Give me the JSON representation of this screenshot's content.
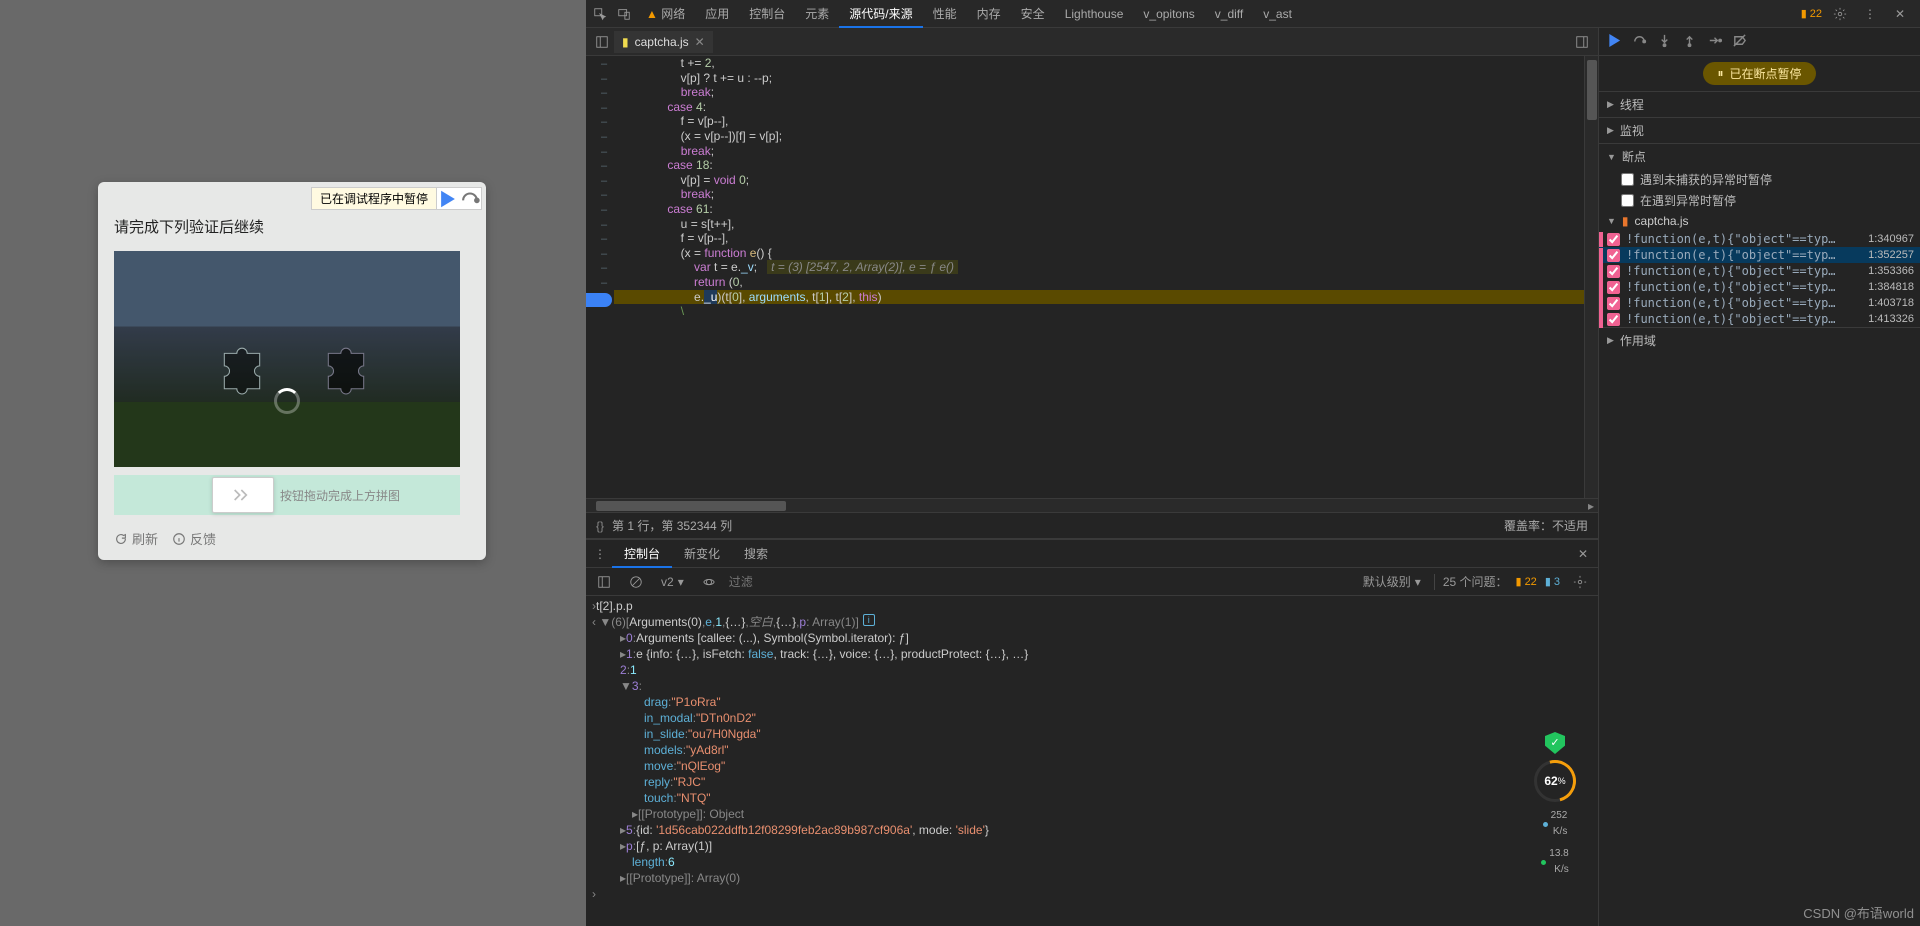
{
  "captcha": {
    "debugger_strip": "已在调试程序中暂停",
    "title": "请完成下列验证后继续",
    "slider_hint": "按钮拖动完成上方拼图",
    "refresh": "刷新",
    "feedback": "反馈"
  },
  "devtools": {
    "tabs": {
      "network": "网络",
      "application": "应用",
      "console": "控制台",
      "elements": "元素",
      "sources": "源代码/来源",
      "performance": "性能",
      "memory": "内存",
      "security": "安全",
      "lighthouse": "Lighthouse",
      "v_options": "v_opitons",
      "v_diff": "v_diff",
      "v_ast": "v_ast"
    },
    "issues_count": "22",
    "file_tab": "captcha.js",
    "status": {
      "pos": "第 1 行，第 352344 列",
      "coverage": "覆盖率：不适用"
    },
    "pause_banner": "已在断点暂停",
    "sections": {
      "threads": "线程",
      "watch": "监视",
      "breakpoints": "断点",
      "scope": "作用域"
    },
    "bp_opts": {
      "uncaught": "遇到未捕获的异常时暂停",
      "caught": "在遇到异常时暂停"
    },
    "bp_file": "captcha.js",
    "bp_list": [
      {
        "label": "!function(e,t){\"object\"==typ…",
        "loc": "1:340967"
      },
      {
        "label": "!function(e,t){\"object\"==typ…",
        "loc": "1:352257"
      },
      {
        "label": "!function(e,t){\"object\"==typ…",
        "loc": "1:353366"
      },
      {
        "label": "!function(e,t){\"object\"==typ…",
        "loc": "1:384818"
      },
      {
        "label": "!function(e,t){\"object\"==typ…",
        "loc": "1:403718"
      },
      {
        "label": "!function(e,t){\"object\"==typ…",
        "loc": "1:413326"
      }
    ]
  },
  "code": {
    "inline_eval": "t = (3) [2547, 2, Array(2)], e = ƒ e()"
  },
  "console": {
    "tabs": {
      "console": "控制台",
      "changes": "新变化",
      "search": "搜索"
    },
    "context": "v2",
    "filter_placeholder": "过滤",
    "level": "默认级别",
    "issues_label": "25 个问题：",
    "issues_warn": "22",
    "issues_info": "3",
    "expr": "t[2].p.p",
    "result_header": "(6) [Arguments(0), e, 1, {…}, 空白, {…}, p: Array(1)]",
    "item0": "Arguments [callee: (...), Symbol(Symbol.iterator): ƒ]",
    "item1": "e {info: {…}, isFetch: false, track: {…}, voice: {…}, productProtect: {…}, …}",
    "item2": "1",
    "item3_props": {
      "drag": "\"P1oRra\"",
      "in_modal": "\"DTn0nD2\"",
      "in_slide": "\"ou7H0Ngda\"",
      "models": "\"yAd8rl\"",
      "move": "\"nQlEog\"",
      "reply": "\"RJC\"",
      "touch": "\"NTQ\""
    },
    "proto3": "[[Prototype]]: Object",
    "item5": "{id: '1d56cab022ddfb12f08299feb2ac89b987cf906a', mode: 'slide'}",
    "item_p": "[ƒ, p: Array(1)]",
    "length": "6",
    "proto_outer": "[[Prototype]]: Array(0)"
  },
  "perf": {
    "score": "62",
    "up": "252",
    "up_unit": "K/s",
    "down": "13.8",
    "down_unit": "K/s"
  },
  "watermark": "CSDN @布语world"
}
